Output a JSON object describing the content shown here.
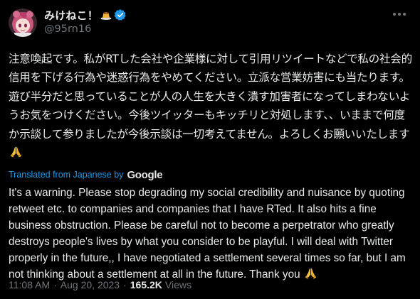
{
  "author": {
    "display_name": "みけねこ！",
    "handle": "@95rn16",
    "verified": true,
    "avatar_icon": "avatar-anime-girl",
    "name_emoji": "pudding-emoji"
  },
  "tweet": {
    "text_ja": "注意喚起です。私がRTした会社や企業様に対して引用リツイートなどで私の社会的信用を下げる行為や迷惑行為をやめてください。立派な営業妨害にも当たります。遊び半分だと思っていることが人の人生を大きく潰す加害者になってしまわないようお気をつけください。今後ツイッターもキッチリと対処します、、いままで何度か示談して参りましたが今後示談は一切考えてません。よろしくお願いいたします",
    "translated_label": "Translated from Japanese by",
    "translator": "Google",
    "text_en": "It's a warning. Please stop degrading my social credibility and nuisance by quoting retweet etc. to companies and companies that I have RTed. It also hits a fine business obstruction. Please be careful not to become a perpetrator who greatly destroys people's lives by what you consider to be playful. I will deal with Twitter properly in the future,, I have negotiated a settlement several times so far, but I am not thinking about a settlement at all in the future. Thank you"
  },
  "meta": {
    "time": "11:08 AM",
    "separator": "·",
    "date": "Aug 20, 2023",
    "views_count": "165.2K",
    "views_label": "Views"
  },
  "colors": {
    "background": "#000000",
    "text": "#e7e9ea",
    "muted": "#71767b",
    "link": "#1d9bf0"
  }
}
